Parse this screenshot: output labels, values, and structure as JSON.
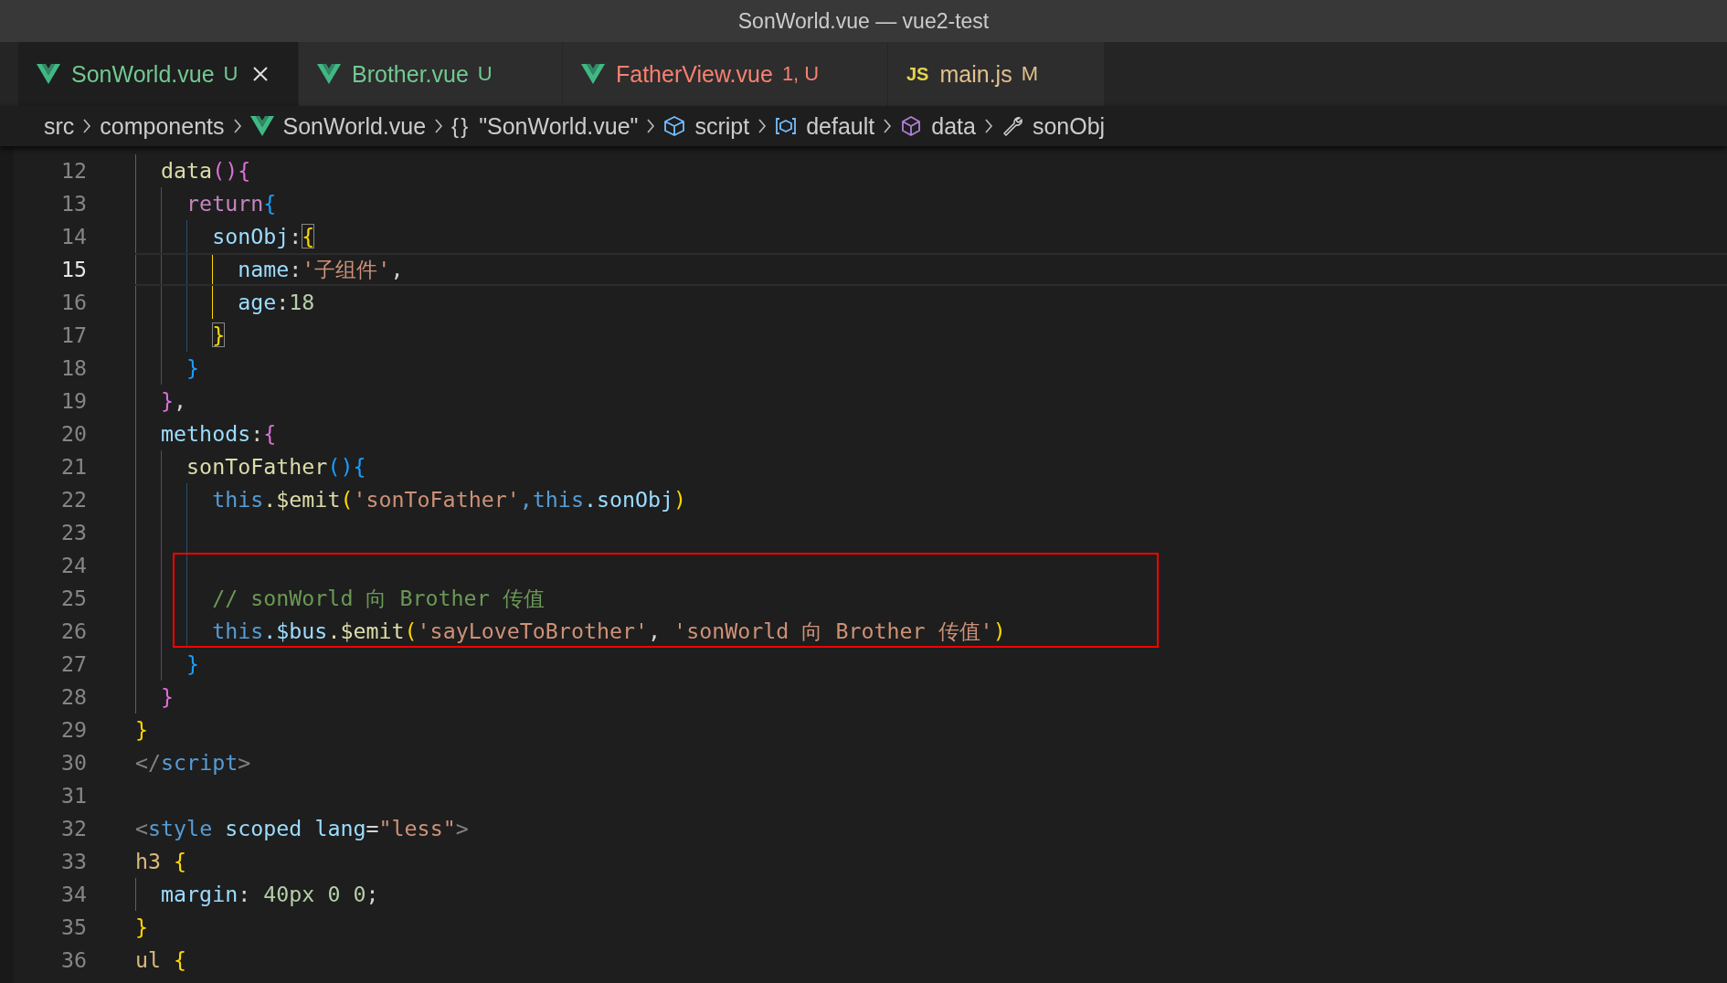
{
  "window": {
    "title": "SonWorld.vue — vue2-test"
  },
  "tabs": [
    {
      "kind": "vue",
      "label": "SonWorld.vue",
      "status": "U",
      "color": "#73c991",
      "selected": true
    },
    {
      "kind": "vue",
      "label": "Brother.vue",
      "status": "U",
      "color": "#73c991",
      "selected": false
    },
    {
      "kind": "vue",
      "label": "FatherView.vue",
      "status": "1, U",
      "color": "#f88070",
      "selected": false
    },
    {
      "kind": "js",
      "icon_text": "JS",
      "label": "main.js",
      "status": "M",
      "color": "#e2c08d",
      "selected": false
    }
  ],
  "breadcrumbs": [
    {
      "kind": "plain",
      "label": "src"
    },
    {
      "kind": "plain",
      "label": "components"
    },
    {
      "kind": "vue",
      "label": "SonWorld.vue"
    },
    {
      "kind": "braces",
      "icon_text": "{}",
      "label": "\"SonWorld.vue\""
    },
    {
      "kind": "module",
      "label": "script"
    },
    {
      "kind": "variable",
      "label": "default"
    },
    {
      "kind": "method",
      "label": "data"
    },
    {
      "kind": "property",
      "label": "sonObj"
    }
  ],
  "editor": {
    "lines": [
      {
        "number": "12",
        "current": false,
        "boxed": false,
        "guides": [
          {
            "color": "#6e6324"
          }
        ],
        "tokens": [
          {
            "kind": "fn",
            "text": "data"
          },
          {
            "kind": "b2",
            "text": "(){"
          }
        ]
      },
      {
        "number": "13",
        "current": false,
        "boxed": false,
        "guides": [
          {
            "color": "#6e6324"
          },
          {
            "color": "#6b3f6b"
          }
        ],
        "tokens": [
          {
            "kind": "kw",
            "text": "return"
          },
          {
            "kind": "b3",
            "text": "{"
          }
        ]
      },
      {
        "number": "14",
        "current": false,
        "boxed": false,
        "guides": [
          {
            "color": "#6e6324"
          },
          {
            "color": "#6b3f6b"
          },
          {
            "color": "#28506e"
          }
        ],
        "tokens": [
          {
            "kind": "prop",
            "text": "sonObj"
          },
          {
            "kind": "punct",
            "text": ":"
          },
          {
            "kind": "b1",
            "text": "{",
            "matched": true
          }
        ]
      },
      {
        "number": "15",
        "current": true,
        "boxed": false,
        "guides": [
          {
            "color": "#6e6324"
          },
          {
            "color": "#6b3f6b"
          },
          {
            "color": "#28506e"
          },
          {
            "color": "#ffd700"
          }
        ],
        "tokens": [
          {
            "kind": "prop",
            "text": "name"
          },
          {
            "kind": "punct",
            "text": ":"
          },
          {
            "kind": "str",
            "text": "'子组件'"
          },
          {
            "kind": "punct",
            "text": ","
          }
        ]
      },
      {
        "number": "16",
        "current": false,
        "boxed": false,
        "guides": [
          {
            "color": "#6e6324"
          },
          {
            "color": "#6b3f6b"
          },
          {
            "color": "#28506e"
          },
          {
            "color": "#ffd700"
          }
        ],
        "tokens": [
          {
            "kind": "prop",
            "text": "age"
          },
          {
            "kind": "punct",
            "text": ":"
          },
          {
            "kind": "num",
            "text": "18"
          }
        ]
      },
      {
        "number": "17",
        "current": false,
        "boxed": false,
        "guides": [
          {
            "color": "#6e6324"
          },
          {
            "color": "#6b3f6b"
          },
          {
            "color": "#28506e"
          }
        ],
        "tokens": [
          {
            "kind": "b1",
            "text": "}",
            "matched": true
          }
        ]
      },
      {
        "number": "18",
        "current": false,
        "boxed": false,
        "guides": [
          {
            "color": "#6e6324"
          },
          {
            "color": "#6b3f6b"
          }
        ],
        "tokens": [
          {
            "kind": "b3",
            "text": "}"
          }
        ]
      },
      {
        "number": "19",
        "current": false,
        "boxed": false,
        "guides": [
          {
            "color": "#6e6324"
          }
        ],
        "tokens": [
          {
            "kind": "b2",
            "text": "}"
          },
          {
            "kind": "punct",
            "text": ","
          }
        ]
      },
      {
        "number": "20",
        "current": false,
        "boxed": false,
        "guides": [
          {
            "color": "#6e6324"
          }
        ],
        "tokens": [
          {
            "kind": "prop",
            "text": "methods"
          },
          {
            "kind": "punct",
            "text": ":"
          },
          {
            "kind": "b2",
            "text": "{"
          }
        ]
      },
      {
        "number": "21",
        "current": false,
        "boxed": false,
        "guides": [
          {
            "color": "#6e6324"
          },
          {
            "color": "#6b3f6b"
          }
        ],
        "tokens": [
          {
            "kind": "fn",
            "text": "sonToFather"
          },
          {
            "kind": "b3",
            "text": "(){"
          }
        ]
      },
      {
        "number": "22",
        "current": false,
        "boxed": false,
        "guides": [
          {
            "color": "#6e6324"
          },
          {
            "color": "#6b3f6b"
          },
          {
            "color": "#28506e"
          }
        ],
        "tokens": [
          {
            "kind": "this",
            "text": "this"
          },
          {
            "kind": "fn",
            "text": ".$emit"
          },
          {
            "kind": "b1",
            "text": "("
          },
          {
            "kind": "str",
            "text": "'sonToFather'"
          },
          {
            "kind": "this",
            "text": ",this"
          },
          {
            "kind": "prop",
            "text": ".sonObj"
          },
          {
            "kind": "b1",
            "text": ")"
          }
        ]
      },
      {
        "number": "23",
        "current": false,
        "boxed": false,
        "guides": [
          {
            "color": "#6e6324"
          },
          {
            "color": "#6b3f6b"
          },
          {
            "color": "#28506e"
          }
        ]
      },
      {
        "number": "24",
        "current": false,
        "boxed": true,
        "guides": [
          {
            "color": "#6e6324"
          },
          {
            "color": "#6b3f6b"
          },
          {
            "color": "#28506e"
          }
        ]
      },
      {
        "number": "25",
        "current": false,
        "boxed": true,
        "guides": [
          {
            "color": "#6e6324"
          },
          {
            "color": "#6b3f6b"
          },
          {
            "color": "#28506e"
          }
        ],
        "tokens": [
          {
            "kind": "comment",
            "text": "// sonWorld 向 Brother 传值"
          }
        ]
      },
      {
        "number": "26",
        "current": false,
        "boxed": true,
        "guides": [
          {
            "color": "#6e6324"
          },
          {
            "color": "#6b3f6b"
          },
          {
            "color": "#28506e"
          }
        ],
        "tokens": [
          {
            "kind": "this",
            "text": "this"
          },
          {
            "kind": "prop",
            "text": ".$bus"
          },
          {
            "kind": "fn",
            "text": ".$emit"
          },
          {
            "kind": "b1",
            "text": "("
          },
          {
            "kind": "str",
            "text": "'sayLoveToBrother'"
          },
          {
            "kind": "punct",
            "text": ","
          },
          {
            "kind": "str",
            "text": " 'sonWorld 向 Brother 传值'"
          },
          {
            "kind": "b1",
            "text": ")"
          }
        ]
      },
      {
        "number": "27",
        "current": false,
        "boxed": false,
        "guides": [
          {
            "color": "#6e6324"
          },
          {
            "color": "#6b3f6b"
          }
        ],
        "tokens": [
          {
            "kind": "b3",
            "text": "}"
          }
        ]
      },
      {
        "number": "28",
        "current": false,
        "boxed": false,
        "guides": [
          {
            "color": "#6e6324"
          }
        ],
        "tokens": [
          {
            "kind": "b2",
            "text": "}"
          }
        ]
      },
      {
        "number": "29",
        "current": false,
        "boxed": false,
        "tokens": [
          {
            "kind": "b1",
            "text": "}"
          }
        ]
      },
      {
        "number": "30",
        "current": false,
        "boxed": false,
        "tokens": [
          {
            "kind": "tagp",
            "text": "</"
          },
          {
            "kind": "tag",
            "text": "script"
          },
          {
            "kind": "tagp",
            "text": ">"
          }
        ]
      },
      {
        "number": "31",
        "current": false,
        "boxed": false
      },
      {
        "number": "32",
        "current": false,
        "boxed": false,
        "tokens": [
          {
            "kind": "tagp",
            "text": "<"
          },
          {
            "kind": "tag",
            "text": "style"
          },
          {
            "kind": "prop",
            "text": " scoped"
          },
          {
            "kind": "prop",
            "text": " lang"
          },
          {
            "kind": "punct",
            "text": "="
          },
          {
            "kind": "str",
            "text": "\"less\""
          },
          {
            "kind": "tagp",
            "text": ">"
          }
        ]
      },
      {
        "number": "33",
        "current": false,
        "boxed": false,
        "tokens": [
          {
            "kind": "sel",
            "text": "h3"
          },
          {
            "kind": "b1",
            "text": " {"
          }
        ]
      },
      {
        "number": "34",
        "current": false,
        "boxed": false,
        "guides": [
          {
            "color": "#6e6324"
          }
        ],
        "tokens": [
          {
            "kind": "prop",
            "text": "margin"
          },
          {
            "kind": "punct",
            "text": ":"
          },
          {
            "kind": "num",
            "text": " 40px 0 0"
          },
          {
            "kind": "punct",
            "text": ";"
          }
        ]
      },
      {
        "number": "35",
        "current": false,
        "boxed": false,
        "tokens": [
          {
            "kind": "b1",
            "text": "}"
          }
        ]
      },
      {
        "number": "36",
        "current": false,
        "boxed": false,
        "tokens": [
          {
            "kind": "sel",
            "text": "ul"
          },
          {
            "kind": "b1",
            "text": " {"
          }
        ]
      }
    ]
  }
}
